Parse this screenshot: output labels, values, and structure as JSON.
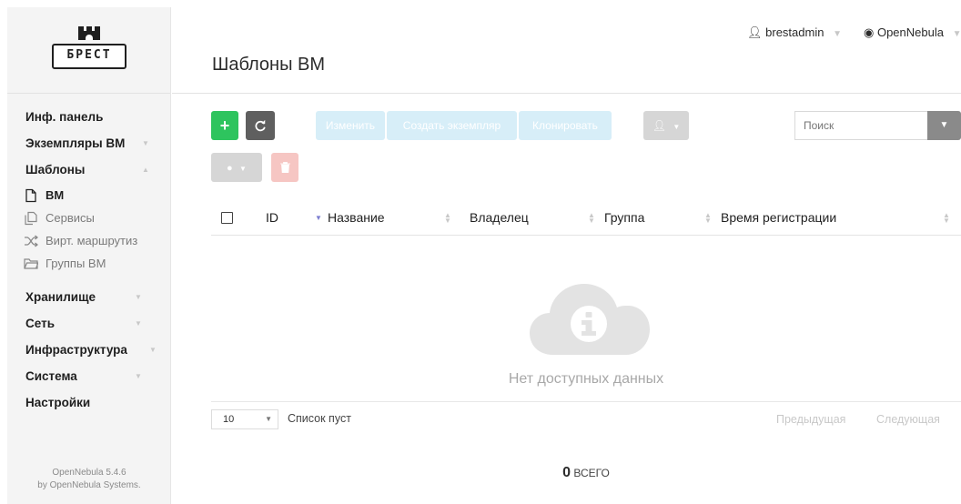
{
  "logo": {
    "text": "БРЕСТ"
  },
  "header": {
    "title": "Шаблоны ВМ",
    "user": "brestadmin",
    "zone": "OpenNebula"
  },
  "sidebar": {
    "items": [
      {
        "label": "Инф. панель"
      },
      {
        "label": "Экземпляры ВМ"
      },
      {
        "label": "Шаблоны"
      },
      {
        "label": "Хранилище"
      },
      {
        "label": "Сеть"
      },
      {
        "label": "Инфраструктура"
      },
      {
        "label": "Система"
      },
      {
        "label": "Настройки"
      }
    ],
    "sub_items": [
      {
        "label": "ВМ",
        "icon": "file-icon"
      },
      {
        "label": "Сервисы",
        "icon": "copy-icon"
      },
      {
        "label": "Вирт. маршрутиз",
        "icon": "shuffle-icon"
      },
      {
        "label": "Группы ВМ",
        "icon": "folder-icon"
      }
    ],
    "version_line1": "OpenNebula 5.4.6",
    "version_line2": "by OpenNebula Systems."
  },
  "toolbar": {
    "add_label": "+",
    "edit_label": "Изменить",
    "instantiate_label": "Создать экземпляр",
    "clone_label": "Клонировать",
    "search_placeholder": "Поиск"
  },
  "table": {
    "columns": [
      "ID",
      "Название",
      "Владелец",
      "Группа",
      "Время регистрации"
    ],
    "empty_text": "Нет доступных данных"
  },
  "footer": {
    "page_size": "10",
    "list_status": "Список пуст",
    "prev_label": "Предыдущая",
    "next_label": "Следующая",
    "total_count": "0",
    "total_label": "ВСЕГО"
  },
  "colors": {
    "add": "#2ec45e",
    "refresh": "#5f5f5f",
    "action_light": "#d7eef8",
    "delete_light": "#f6c6c3",
    "sort_active": "#7c7ed0"
  }
}
